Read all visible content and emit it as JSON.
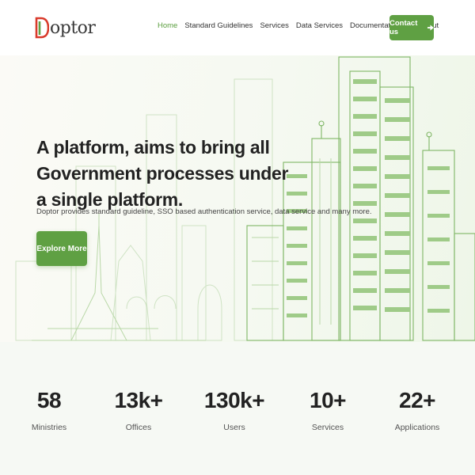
{
  "brand": {
    "name": "Doptor",
    "colors": {
      "green": "#5fa043",
      "red": "#d93a2b",
      "text": "#222222"
    }
  },
  "nav": {
    "items": [
      {
        "label": "Home",
        "active": true
      },
      {
        "label": "Standard Guidelines"
      },
      {
        "label": "Services"
      },
      {
        "label": "Data Services"
      },
      {
        "label": "Documentations",
        "dropdown": true
      },
      {
        "label": "About"
      }
    ],
    "contact_label": "Contact us",
    "contact_icon": "arrow-right-icon"
  },
  "hero": {
    "title": "A platform, aims to bring all Government processes under a single platform.",
    "subtitle": "Doptor provides standard guideline, SSO based authentication service, data service and many more.",
    "cta_label": "Explore More"
  },
  "stats": [
    {
      "value": "58",
      "label": "Ministries"
    },
    {
      "value": "13k+",
      "label": "Offices"
    },
    {
      "value": "130k+",
      "label": "Users"
    },
    {
      "value": "10+",
      "label": "Services"
    },
    {
      "value": "22+",
      "label": "Applications"
    }
  ]
}
